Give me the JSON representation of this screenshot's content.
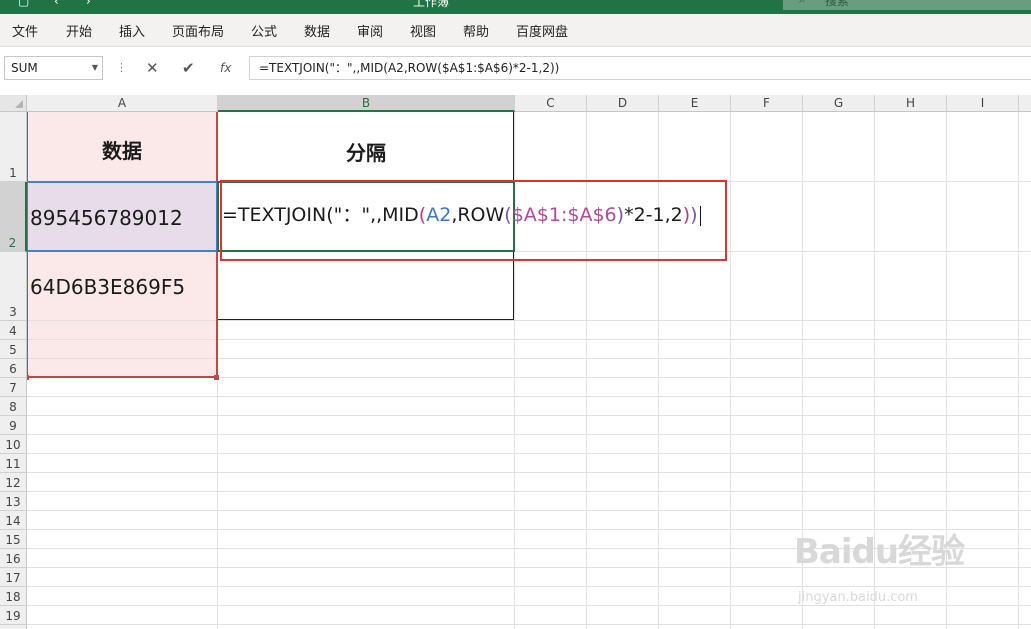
{
  "titlebar": {
    "title": "工作簿",
    "search_label": "搜索"
  },
  "menu": [
    "文件",
    "开始",
    "插入",
    "页面布局",
    "公式",
    "数据",
    "审阅",
    "视图",
    "帮助",
    "百度网盘"
  ],
  "formula_bar": {
    "name_box": "SUM",
    "cancel_symbol": "✕",
    "enter_symbol": "✔",
    "fx_label": "fx",
    "formula": "=TEXTJOIN(\"：\",,MID(A2,ROW($A$1:$A$6)*2-1,2))"
  },
  "columns": [
    "A",
    "B",
    "C",
    "D",
    "E",
    "F",
    "G",
    "H",
    "I"
  ],
  "rows": [
    "1",
    "2",
    "3",
    "4",
    "5",
    "6",
    "7",
    "8",
    "9",
    "10",
    "11",
    "12",
    "13",
    "14",
    "15",
    "16",
    "17",
    "18",
    "19"
  ],
  "cells": {
    "A1": "数据",
    "B1": "分隔",
    "A2": "895456789012",
    "A3": "64D6B3E869F5"
  },
  "edit_formula": {
    "p1": "=TEXTJOIN(\"：\",,MID",
    "p2": "(",
    "p3": "A2",
    "p4": ",ROW",
    "p5": "(",
    "p6": "$A$1:$A$6",
    "p7": ")",
    "p8": "*2-1,2",
    "p9": ")",
    "p10": ")"
  },
  "colors": {
    "ref_a2": "#3b76c8",
    "ref_range": "#b24a9b",
    "paren_outer": "#c0397c",
    "paren_inner": "#7a55b3",
    "highlight_box": "#e03030",
    "excel_green": "#217346"
  },
  "watermark": {
    "text": "Baidu经验",
    "url": "jingyan.baidu.com"
  }
}
